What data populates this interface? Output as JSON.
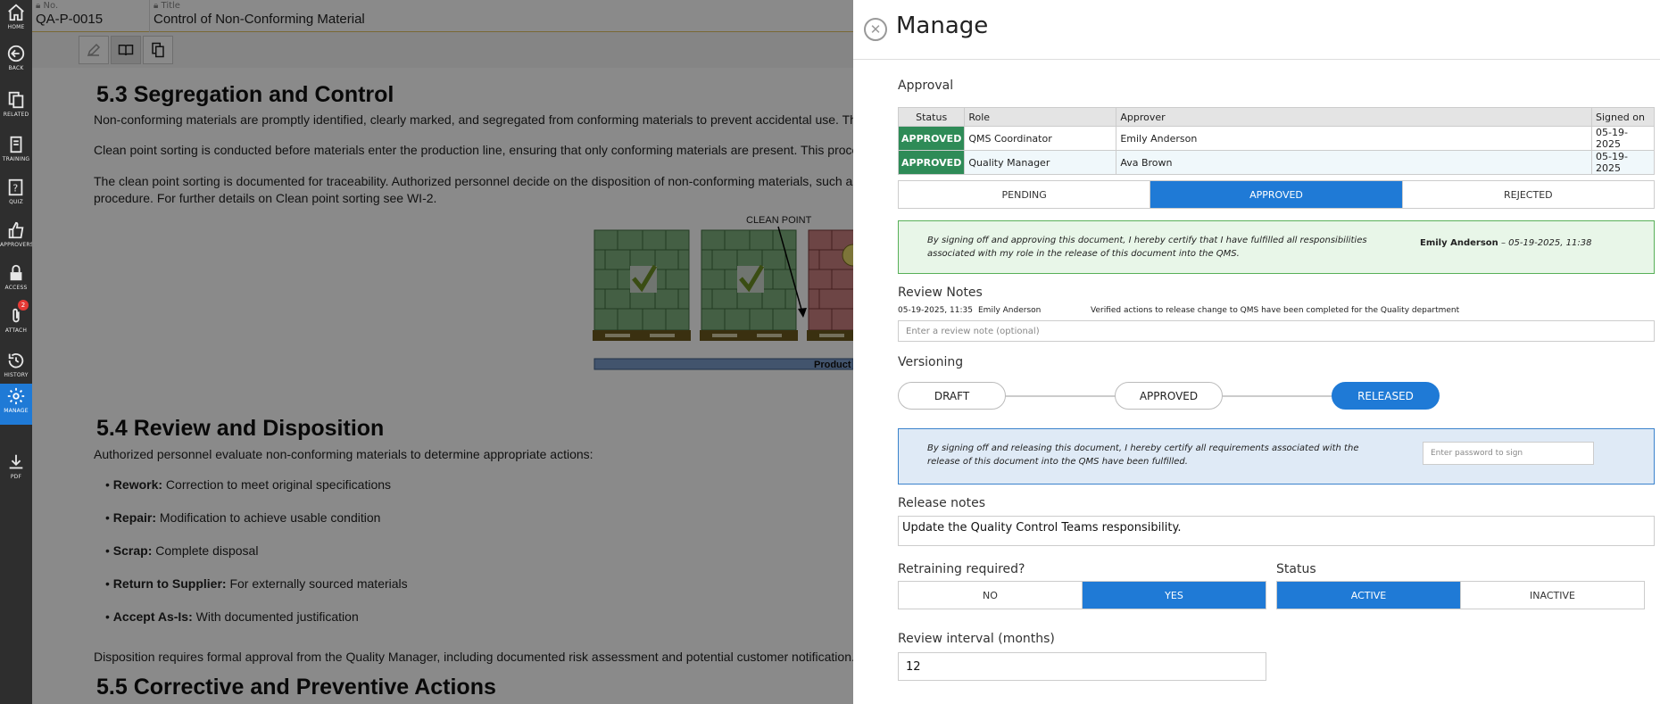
{
  "sidebar": {
    "items": [
      {
        "label": "HOME",
        "icon": "home-icon"
      },
      {
        "label": "BACK",
        "icon": "back-arrow-icon"
      },
      {
        "label": "RELATED",
        "icon": "related-documents-icon"
      },
      {
        "label": "TRAINING",
        "icon": "training-icon"
      },
      {
        "label": "QUIZ",
        "icon": "quiz-icon"
      },
      {
        "label": "APPROVERS",
        "icon": "thumbs-up-icon"
      },
      {
        "label": "ACCESS",
        "icon": "lock-icon"
      },
      {
        "label": "ATTACH",
        "icon": "paperclip-icon",
        "badge": "2"
      },
      {
        "label": "HISTORY",
        "icon": "history-icon"
      },
      {
        "label": "MANAGE",
        "icon": "gear-icon",
        "active": true
      },
      {
        "label": "PDF",
        "icon": "download-icon"
      }
    ]
  },
  "doc_header": {
    "no_label": "No.",
    "no_value": "QA-P-0015",
    "title_label": "Title",
    "title_value": "Control of Non-Conforming Material"
  },
  "toolbar": {
    "buttons": [
      "edit-icon",
      "read-book-icon",
      "copy-document-icon"
    ]
  },
  "document": {
    "s53_heading": "5.3 Segregation and Control",
    "s53_p1": "Non-conforming materials are promptly identified, clearly marked, and segregated from conforming materials to prevent accidental use. The",
    "s53_p2": "Clean point sorting is conducted before materials enter the production line, ensuring that only conforming materials are present. This proces",
    "s53_p3a": "The clean point sorting is documented for traceability. Authorized personnel decide on the disposition of non-conforming materials, such as",
    "s53_p3b": "procedure. For further details on Clean point sorting see WI-2.",
    "figure_callout": "CLEAN POINT",
    "figure_bar_label": "Product",
    "s54_heading": "5.4 Review and Disposition",
    "s54_p1": "Authorized personnel evaluate non-conforming materials to determine appropriate actions:",
    "bullets": [
      {
        "term": "Rework:",
        "text": " Correction to meet original specifications"
      },
      {
        "term": "Repair:",
        "text": " Modification to achieve usable condition"
      },
      {
        "term": "Scrap:",
        "text": " Complete disposal"
      },
      {
        "term": "Return to Supplier:",
        "text": " For externally sourced materials"
      },
      {
        "term": "Accept As-Is:",
        "text": " With documented justification"
      }
    ],
    "s54_p2": "Disposition requires formal approval from the Quality Manager, including documented risk assessment and potential customer notification.",
    "s55_heading": "5.5 Corrective and Preventive Actions"
  },
  "manage": {
    "title": "Manage",
    "approval": {
      "heading": "Approval",
      "columns": [
        "Status",
        "Role",
        "Approver",
        "Signed on"
      ],
      "rows": [
        {
          "status": "APPROVED",
          "role": "QMS Coordinator",
          "approver": "Emily Anderson",
          "signed": "05-19-2025"
        },
        {
          "status": "APPROVED",
          "role": "Quality Manager",
          "approver": "Ava Brown",
          "signed": "05-19-2025"
        }
      ],
      "options": [
        "PENDING",
        "APPROVED",
        "REJECTED"
      ],
      "selected": "APPROVED",
      "cert_text": "By signing off and approving this document, I hereby certify that I have fulfilled all responsibilities associated with my role in the release of this document into the QMS.",
      "signer": "Emily Anderson",
      "signed_at": " – 05-19-2025, 11:38"
    },
    "review_notes": {
      "heading": "Review Notes",
      "entry_time": "05-19-2025, 11:35",
      "entry_user": "Emily Anderson",
      "entry_text": "Verified actions to release change to QMS have been completed for the Quality department",
      "placeholder": "Enter a review note (optional)"
    },
    "versioning": {
      "heading": "Versioning",
      "stages": [
        "DRAFT",
        "APPROVED",
        "RELEASED"
      ],
      "current": "RELEASED",
      "cert_text": "By signing off and releasing this document, I hereby certify all requirements associated with the release of this document into the QMS have been fulfilled.",
      "password_placeholder": "Enter password to sign"
    },
    "release_notes": {
      "heading": "Release notes",
      "value": "Update the Quality Control Teams responsibility."
    },
    "retraining": {
      "heading": "Retraining required?",
      "options": [
        "NO",
        "YES"
      ],
      "selected": "YES"
    },
    "status": {
      "heading": "Status",
      "options": [
        "ACTIVE",
        "INACTIVE"
      ],
      "selected": "ACTIVE"
    },
    "review_interval": {
      "heading": "Review interval (months)",
      "value": "12"
    }
  },
  "colors": {
    "accent": "#1f7ad6",
    "approved_green": "#2e8b57",
    "sidebar_bg": "#2e2e2e",
    "cert_green_bg": "#e8f6e8",
    "cert_blue_bg": "#dfeaf6"
  }
}
